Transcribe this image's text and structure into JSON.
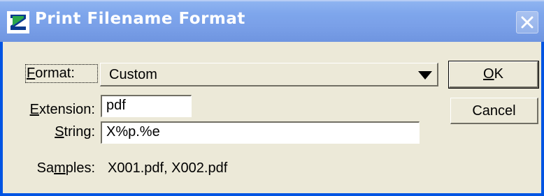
{
  "window": {
    "title": "Print Filename Format",
    "app_icon": "microstation-icon",
    "close_icon": "close-icon"
  },
  "form": {
    "format": {
      "label_accel": "F",
      "label_rest": "ormat:",
      "value": "Custom"
    },
    "extension": {
      "label_accel": "E",
      "label_rest": "xtension:",
      "value": "pdf"
    },
    "string": {
      "label_accel": "S",
      "label_rest": "tring:",
      "value": "X%p.%e"
    },
    "samples": {
      "label_pre": "Sa",
      "label_accel": "m",
      "label_rest": "ples:",
      "value": "X001.pdf, X002.pdf"
    }
  },
  "buttons": {
    "ok_accel": "O",
    "ok_rest": "K",
    "cancel": "Cancel"
  },
  "colors": {
    "titlebar": "#7aa0e8",
    "dialog_bg": "#ece9d8",
    "border": "#0054e3"
  }
}
